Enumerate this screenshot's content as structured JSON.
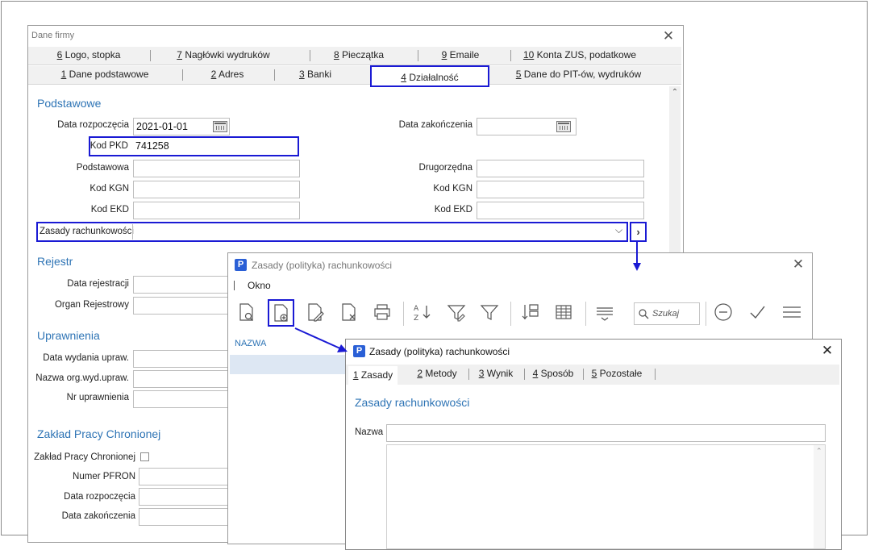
{
  "main_window": {
    "title": "Dane firmy",
    "tabs_row1": [
      {
        "num": "6",
        "label": " Logo, stopka"
      },
      {
        "num": "7",
        "label": " Nagłówki wydruków"
      },
      {
        "num": "8",
        "label": " Pieczątka"
      },
      {
        "num": "9",
        "label": " Emaile"
      },
      {
        "num": "10",
        "label": " Konta ZUS, podatkowe"
      }
    ],
    "tabs_row2": [
      {
        "num": "1",
        "label": " Dane podstawowe"
      },
      {
        "num": "2",
        "label": " Adres"
      },
      {
        "num": "3",
        "label": " Banki"
      },
      {
        "num": "4",
        "label": " Działalność"
      },
      {
        "num": "5",
        "label": " Dane do PIT-ów, wydruków"
      }
    ],
    "podstawowe": {
      "heading": "Podstawowe",
      "data_rozpoczecia_label": "Data rozpoczęcia",
      "data_rozpoczecia_value": "2021-01-01",
      "data_zakonczenia_label": "Data zakończenia",
      "data_zakonczenia_value": "",
      "kod_pkd_label": "Kod PKD",
      "kod_pkd_value": "741258",
      "podstawowa_label": "Podstawowa",
      "drugorzedna_label": "Drugorzędna",
      "kod_kgn_label": "Kod KGN",
      "kod_ekd_label": "Kod EKD",
      "zasady_label": "Zasady rachunkowości",
      "zasady_value": ""
    },
    "rejestr": {
      "heading": "Rejestr",
      "data_rejestracji_label": "Data rejestracji",
      "organ_label": "Organ Rejestrowy"
    },
    "uprawnienia": {
      "heading": "Uprawnienia",
      "data_wydania_label": "Data wydania upraw.",
      "nazwa_org_label": "Nazwa org.wyd.upraw.",
      "nr_uprawnienia_label": "Nr uprawnienia"
    },
    "zpch": {
      "heading": "Zakład Pracy Chronionej",
      "zpch_label": "Zakład Pracy Chronionej",
      "pfron_label": "Numer PFRON",
      "data_rozp_label": "Data rozpoczęcia",
      "data_zak_label": "Data zakończenia"
    }
  },
  "list_window": {
    "title": "Zasady (polityka) rachunkowości",
    "menu": [
      "Okno"
    ],
    "search_placeholder": "Szukaj",
    "column_header": "NAZWA",
    "icons": [
      "preview-icon",
      "add-document-icon",
      "edit-icon",
      "delete-icon",
      "print-icon",
      "sort-az-icon",
      "filter-edit-icon",
      "filter-icon",
      "columns-icon",
      "grid-icon",
      "group-icon",
      "search-icon",
      "minus-circle-icon",
      "check-icon",
      "menu-icon"
    ]
  },
  "edit_window": {
    "title": "Zasady (polityka) rachunkowości",
    "tabs": [
      {
        "num": "1",
        "label": " Zasady"
      },
      {
        "num": "2",
        "label": " Metody"
      },
      {
        "num": "3",
        "label": " Wynik"
      },
      {
        "num": "4",
        "label": " Sposób"
      },
      {
        "num": "5",
        "label": " Pozostałe"
      }
    ],
    "section_heading": "Zasady rachunkowości",
    "nazwa_label": "Nazwa",
    "nazwa_value": ""
  },
  "colors": {
    "accent_blue": "#2e74b5",
    "highlight_blue": "#1a1ad4",
    "app_icon_blue": "#2a5fd6",
    "selected_row": "#dde7f3"
  }
}
